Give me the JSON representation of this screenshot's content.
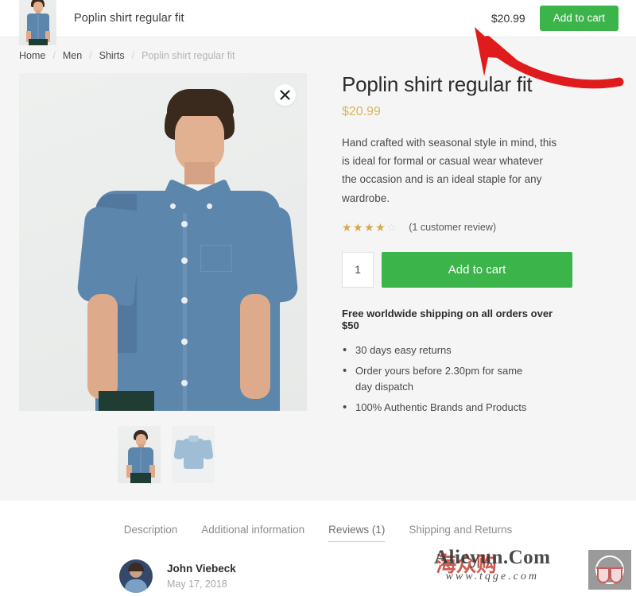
{
  "topbar": {
    "product_title": "Poplin shirt regular fit",
    "price": "$20.99",
    "add_to_cart_label": "Add to cart",
    "thumb_icon": "product-thumbnail"
  },
  "breadcrumb": {
    "items": [
      {
        "label": "Home",
        "current": false
      },
      {
        "label": "Men",
        "current": false
      },
      {
        "label": "Shirts",
        "current": false
      },
      {
        "label": "Poplin shirt regular fit",
        "current": true
      }
    ],
    "separator": "/"
  },
  "gallery": {
    "close_icon": "close-icon",
    "main_image_alt": "Model wearing blue poplin short sleeve shirt",
    "thumbnails": [
      {
        "alt": "Model wearing blue poplin shirt"
      },
      {
        "alt": "Flat lay of light blue poplin shirt"
      }
    ]
  },
  "product": {
    "title": "Poplin shirt regular fit",
    "price": "$20.99",
    "description": "Hand crafted with seasonal style in mind, this is ideal for formal or casual wear whatever the occasion and is an ideal staple for any wardrobe.",
    "rating": {
      "value": 4,
      "max": 5,
      "stars_filled": "★★★★",
      "stars_empty": "☆",
      "review_link_label": "(1 customer review)"
    },
    "quantity": "1",
    "quantity_placeholder": "1",
    "add_to_cart_label": "Add to cart",
    "shipping_note": "Free worldwide shipping on all orders over $50",
    "perks": [
      "30 days easy returns",
      "Order yours before 2.30pm for same day dispatch",
      "100% Authentic Brands and Products"
    ]
  },
  "tabs": [
    {
      "label": "Description",
      "active": false
    },
    {
      "label": "Additional information",
      "active": false
    },
    {
      "label": "Reviews (1)",
      "active": true
    },
    {
      "label": "Shipping and Returns",
      "active": false
    }
  ],
  "review": {
    "author": "John Viebeck",
    "date": "May 17, 2018",
    "avatar_alt": "Reviewer avatar"
  },
  "annotation": {
    "arrow_color": "#e01b1b",
    "arrow_points_to": "topbar-add-to-cart-button"
  },
  "watermarks": {
    "primary_text": "Alieyun.Com",
    "primary_subtext": "www.tqge.com",
    "secondary_text": "海众购",
    "logo_icon": "glasses-logo-icon"
  },
  "colors": {
    "accent_green": "#3bb54a",
    "price_gold": "#d6b759",
    "star_gold": "#d6a846",
    "page_bg": "#f5f5f5",
    "annotation_red": "#e01b1b"
  }
}
